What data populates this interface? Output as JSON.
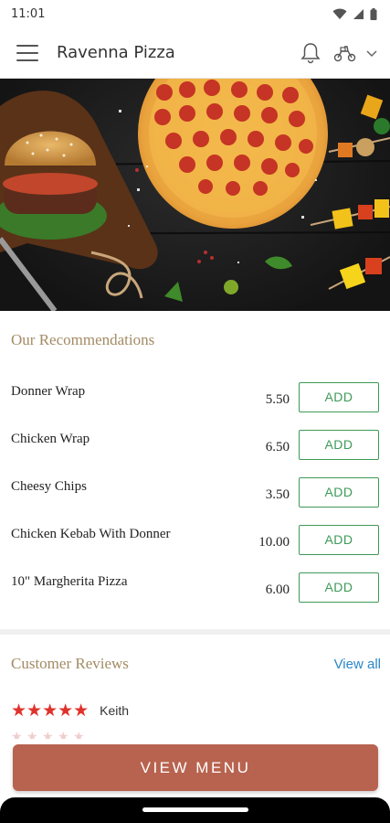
{
  "status_bar": {
    "time": "11:01"
  },
  "app_bar": {
    "title": "Ravenna Pizza"
  },
  "recommendations": {
    "title": "Our Recommendations",
    "add_label": "ADD",
    "items": [
      {
        "name": "Donner Wrap",
        "price": "5.50"
      },
      {
        "name": "Chicken Wrap",
        "price": "6.50"
      },
      {
        "name": "Cheesy Chips",
        "price": "3.50"
      },
      {
        "name": "Chicken Kebab With Donner",
        "price": "10.00"
      },
      {
        "name": "10\" Margherita Pizza",
        "price": "6.00"
      }
    ]
  },
  "reviews": {
    "title": "Customer Reviews",
    "view_all": "View all",
    "items": [
      {
        "stars": "★★★★★",
        "rating": 5,
        "name": "Keith"
      }
    ]
  },
  "view_menu": {
    "label": "VIEW MENU"
  },
  "colors": {
    "accent": "#b8634f",
    "add_green": "#3e9a58",
    "link_blue": "#2a86c6",
    "star_red": "#e0322c",
    "section_title": "#a38b64"
  },
  "icons": {
    "menu": "hamburger-icon",
    "notifications": "bell-icon",
    "delivery": "scooter-icon",
    "dropdown": "chevron-down-icon"
  }
}
